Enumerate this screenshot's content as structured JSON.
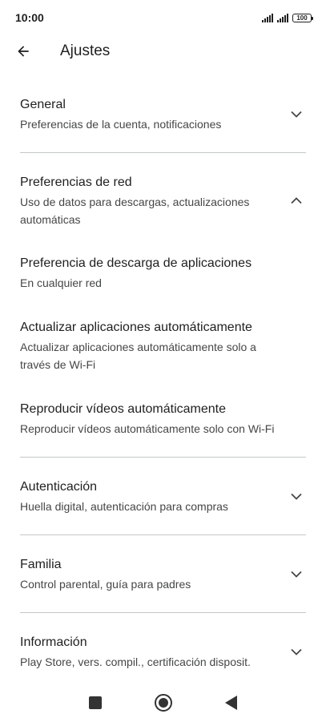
{
  "status_bar": {
    "time": "10:00",
    "battery": "100"
  },
  "app_bar": {
    "title": "Ajustes"
  },
  "sections": {
    "general": {
      "title": "General",
      "subtitle": "Preferencias de la cuenta, notificaciones",
      "expanded": false
    },
    "network": {
      "title": "Preferencias de red",
      "subtitle": "Uso de datos para descargas, actualizaciones automáticas",
      "expanded": true,
      "items": [
        {
          "title": "Preferencia de descarga de aplicaciones",
          "subtitle": "En cualquier red"
        },
        {
          "title": "Actualizar aplicaciones automáticamente",
          "subtitle": "Actualizar aplicaciones automáticamente solo a través de Wi-Fi"
        },
        {
          "title": "Reproducir vídeos automáticamente",
          "subtitle": "Reproducir vídeos automáticamente solo con Wi-Fi"
        }
      ]
    },
    "auth": {
      "title": "Autenticación",
      "subtitle": "Huella digital, autenticación para compras",
      "expanded": false
    },
    "family": {
      "title": "Familia",
      "subtitle": "Control parental, guía para padres",
      "expanded": false
    },
    "info": {
      "title": "Información",
      "subtitle": "Play Store, vers. compil., certificación disposit.",
      "expanded": false
    }
  },
  "colors": {
    "text_primary": "#1f1f1f",
    "text_secondary": "#444746",
    "divider": "#c4c7c5"
  }
}
